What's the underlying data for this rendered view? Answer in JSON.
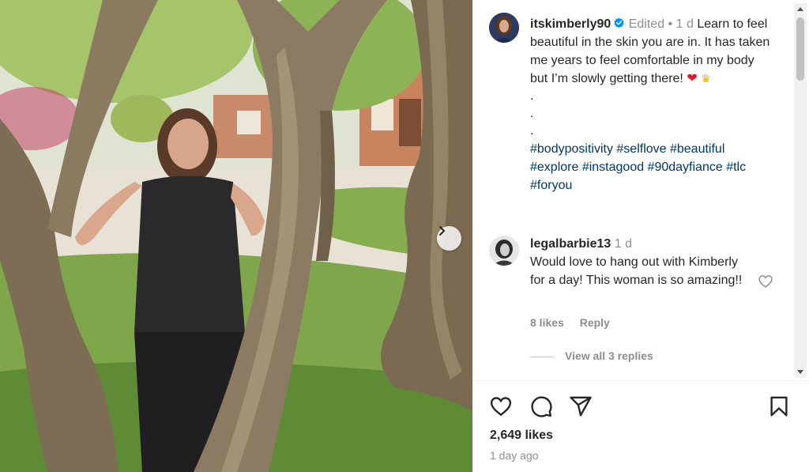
{
  "post": {
    "username": "itskimberly90",
    "edited_label": "Edited",
    "separator": "•",
    "age": "1 d",
    "caption_text": "Learn to feel beautiful in the skin you are in. It has taken me years to feel comfortable in my body but I’m slowly getting there!",
    "emoji_heart": "❤",
    "emoji_crown": "♛",
    "dots": [
      ".",
      ".",
      "."
    ],
    "hashtags_line1": "#bodypositivity #selflove #beautiful",
    "hashtags_line2": "#explore #instagood #90dayfiance #tlc",
    "hashtags_line3": "#foryou"
  },
  "comment": {
    "username": "legalbarbie13",
    "age": "1 d",
    "text": "Would love to hang out with Kimberly for a day! This woman is so amazing!!",
    "likes": "8 likes",
    "reply_label": "Reply",
    "view_replies": "View all 3 replies"
  },
  "footer": {
    "likes": "2,649 likes",
    "date": "1 day ago"
  },
  "icons": {
    "verified": "verified-badge-icon",
    "next": "chevron-right-icon",
    "like": "heart-outline-icon",
    "comment": "comment-bubble-icon",
    "share": "paper-plane-icon",
    "save": "bookmark-icon",
    "comment_like": "heart-outline-icon"
  },
  "colors": {
    "hashtag": "#00376b",
    "muted": "#8e8e8e",
    "verified": "#0095f6",
    "heart_emoji": "#e0162b"
  }
}
